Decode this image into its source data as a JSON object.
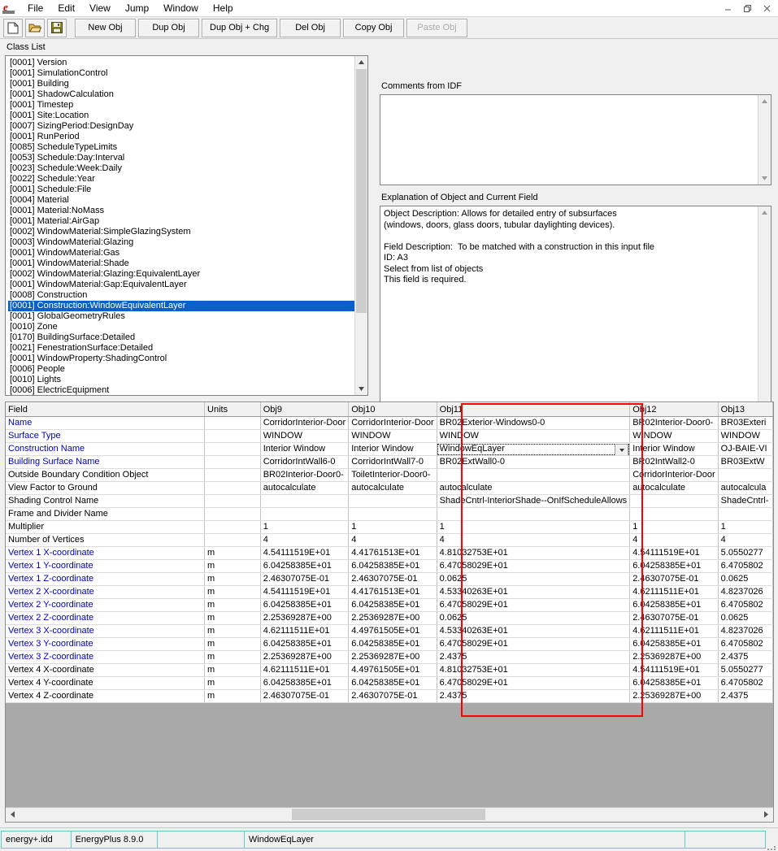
{
  "window": {
    "app_icon": "energyplus-idf-editor-icon",
    "controls": {
      "minimize": "minimize-icon",
      "restore": "restore-icon",
      "close": "close-icon"
    }
  },
  "menubar": {
    "items": [
      {
        "label": "File"
      },
      {
        "label": "Edit"
      },
      {
        "label": "View"
      },
      {
        "label": "Jump"
      },
      {
        "label": "Window"
      },
      {
        "label": "Help"
      }
    ]
  },
  "toolbar": {
    "icons": [
      {
        "name": "new-file-icon"
      },
      {
        "name": "open-folder-icon"
      },
      {
        "name": "save-disk-icon"
      }
    ],
    "buttons": [
      {
        "label": "New Obj",
        "disabled": false
      },
      {
        "label": "Dup Obj",
        "disabled": false
      },
      {
        "label": "Dup Obj + Chg",
        "disabled": false
      },
      {
        "label": "Del Obj",
        "disabled": false
      },
      {
        "label": "Copy Obj",
        "disabled": false
      },
      {
        "label": "Paste Obj",
        "disabled": true
      }
    ]
  },
  "panes": {
    "class_list_label": "Class List",
    "comments_label": "Comments from IDF",
    "comments_value": "",
    "explanation_label": "Explanation of Object and Current Field",
    "explanation_text": "Object Description: Allows for detailed entry of subsurfaces\n(windows, doors, glass doors, tubular daylighting devices).\n\nField Description:  To be matched with a construction in this input file\nID: A3\nSelect from list of objects\nThis field is required."
  },
  "class_list": {
    "selected_index": 23,
    "items": [
      {
        "count": "[0001]",
        "label": "Version"
      },
      {
        "count": "[0001]",
        "label": "SimulationControl"
      },
      {
        "count": "[0001]",
        "label": "Building"
      },
      {
        "count": "[0001]",
        "label": "ShadowCalculation"
      },
      {
        "count": "[0001]",
        "label": "Timestep"
      },
      {
        "count": "[0001]",
        "label": "Site:Location"
      },
      {
        "count": "[0007]",
        "label": "SizingPeriod:DesignDay"
      },
      {
        "count": "[0001]",
        "label": "RunPeriod"
      },
      {
        "count": "[0085]",
        "label": "ScheduleTypeLimits"
      },
      {
        "count": "[0053]",
        "label": "Schedule:Day:Interval"
      },
      {
        "count": "[0023]",
        "label": "Schedule:Week:Daily"
      },
      {
        "count": "[0022]",
        "label": "Schedule:Year"
      },
      {
        "count": "[0001]",
        "label": "Schedule:File"
      },
      {
        "count": "[0004]",
        "label": "Material"
      },
      {
        "count": "[0001]",
        "label": "Material:NoMass"
      },
      {
        "count": "[0001]",
        "label": "Material:AirGap"
      },
      {
        "count": "[0002]",
        "label": "WindowMaterial:SimpleGlazingSystem"
      },
      {
        "count": "[0003]",
        "label": "WindowMaterial:Glazing"
      },
      {
        "count": "[0001]",
        "label": "WindowMaterial:Gas"
      },
      {
        "count": "[0001]",
        "label": "WindowMaterial:Shade"
      },
      {
        "count": "[0002]",
        "label": "WindowMaterial:Glazing:EquivalentLayer"
      },
      {
        "count": "[0001]",
        "label": "WindowMaterial:Gap:EquivalentLayer"
      },
      {
        "count": "[0008]",
        "label": "Construction"
      },
      {
        "count": "[0001]",
        "label": "Construction:WindowEquivalentLayer"
      },
      {
        "count": "[0001]",
        "label": "GlobalGeometryRules"
      },
      {
        "count": "[0010]",
        "label": "Zone"
      },
      {
        "count": "[0170]",
        "label": "BuildingSurface:Detailed"
      },
      {
        "count": "[0021]",
        "label": "FenestrationSurface:Detailed"
      },
      {
        "count": "[0001]",
        "label": "WindowProperty:ShadingControl"
      },
      {
        "count": "[0006]",
        "label": "People"
      },
      {
        "count": "[0010]",
        "label": "Lights"
      },
      {
        "count": "[0006]",
        "label": "ElectricEquipment"
      }
    ]
  },
  "grid": {
    "headers": [
      "Field",
      "Units",
      "Obj9",
      "Obj10",
      "Obj11",
      "Obj12",
      "Obj13"
    ],
    "highlighted_column": "Obj11",
    "editing_cell": {
      "column": "Obj11",
      "row": "Construction Name",
      "value": "WindowEqLayer",
      "dropdown": "chevron-down-icon"
    },
    "rows": [
      {
        "field": "Name",
        "required": true,
        "units": "",
        "values": [
          "CorridorInterior-Door",
          "CorridorInterior-Door",
          "BR02Exterior-Windows0-0",
          "BR02Interior-Door0-",
          "BR03Exteri"
        ]
      },
      {
        "field": "Surface Type",
        "required": true,
        "units": "",
        "values": [
          "WINDOW",
          "WINDOW",
          "WINDOW",
          "WINDOW",
          "WINDOW"
        ]
      },
      {
        "field": "Construction Name",
        "required": true,
        "units": "",
        "values": [
          "Interior Window",
          "Interior Window",
          "WindowEqLayer",
          "Interior Window",
          "OJ-BAIE-VI"
        ]
      },
      {
        "field": "Building Surface Name",
        "required": true,
        "units": "",
        "values": [
          "CorridorIntWall6-0",
          "CorridorIntWall7-0",
          "BR02ExtWall0-0",
          "BR02IntWall2-0",
          "BR03ExtW"
        ]
      },
      {
        "field": "Outside Boundary Condition Object",
        "required": false,
        "units": "",
        "values": [
          "BR02Interior-Door0-",
          "ToiletInterior-Door0-",
          "",
          "CorridorInterior-Door",
          ""
        ]
      },
      {
        "field": "View Factor to Ground",
        "required": false,
        "units": "",
        "values": [
          "autocalculate",
          "autocalculate",
          "autocalculate",
          "autocalculate",
          "autocalcula"
        ]
      },
      {
        "field": "Shading Control Name",
        "required": false,
        "units": "",
        "values": [
          "",
          "",
          "ShadeCntrl-InteriorShade--OnIfScheduleAllows",
          "",
          "ShadeCntrl-"
        ]
      },
      {
        "field": "Frame and Divider Name",
        "required": false,
        "units": "",
        "values": [
          "",
          "",
          "",
          "",
          ""
        ]
      },
      {
        "field": "Multiplier",
        "required": false,
        "units": "",
        "values": [
          "1",
          "1",
          "1",
          "1",
          "1"
        ]
      },
      {
        "field": "Number of Vertices",
        "required": false,
        "units": "",
        "values": [
          "4",
          "4",
          "4",
          "4",
          "4"
        ]
      },
      {
        "field": "Vertex 1 X-coordinate",
        "required": true,
        "units": "m",
        "values": [
          "4.54111519E+01",
          "4.41761513E+01",
          "4.81032753E+01",
          "4.54111519E+01",
          "5.0550277"
        ]
      },
      {
        "field": "Vertex 1 Y-coordinate",
        "required": true,
        "units": "m",
        "values": [
          "6.04258385E+01",
          "6.04258385E+01",
          "6.47058029E+01",
          "6.04258385E+01",
          "6.4705802"
        ]
      },
      {
        "field": "Vertex 1 Z-coordinate",
        "required": true,
        "units": "m",
        "values": [
          "2.46307075E-01",
          "2.46307075E-01",
          "0.0625",
          "2.46307075E-01",
          "0.0625"
        ]
      },
      {
        "field": "Vertex 2 X-coordinate",
        "required": true,
        "units": "m",
        "values": [
          "4.54111519E+01",
          "4.41761513E+01",
          "4.53340263E+01",
          "4.62111511E+01",
          "4.8237026"
        ]
      },
      {
        "field": "Vertex 2 Y-coordinate",
        "required": true,
        "units": "m",
        "values": [
          "6.04258385E+01",
          "6.04258385E+01",
          "6.47058029E+01",
          "6.04258385E+01",
          "6.4705802"
        ]
      },
      {
        "field": "Vertex 2 Z-coordinate",
        "required": true,
        "units": "m",
        "values": [
          "2.25369287E+00",
          "2.25369287E+00",
          "0.0625",
          "2.46307075E-01",
          "0.0625"
        ]
      },
      {
        "field": "Vertex 3 X-coordinate",
        "required": true,
        "units": "m",
        "values": [
          "4.62111511E+01",
          "4.49761505E+01",
          "4.53340263E+01",
          "4.62111511E+01",
          "4.8237026"
        ]
      },
      {
        "field": "Vertex 3 Y-coordinate",
        "required": true,
        "units": "m",
        "values": [
          "6.04258385E+01",
          "6.04258385E+01",
          "6.47058029E+01",
          "6.04258385E+01",
          "6.4705802"
        ]
      },
      {
        "field": "Vertex 3 Z-coordinate",
        "required": true,
        "units": "m",
        "values": [
          "2.25369287E+00",
          "2.25369287E+00",
          "2.4375",
          "2.25369287E+00",
          "2.4375"
        ]
      },
      {
        "field": "Vertex 4 X-coordinate",
        "required": false,
        "units": "m",
        "values": [
          "4.62111511E+01",
          "4.49761505E+01",
          "4.81032753E+01",
          "4.54111519E+01",
          "5.0550277"
        ]
      },
      {
        "field": "Vertex 4 Y-coordinate",
        "required": false,
        "units": "m",
        "values": [
          "6.04258385E+01",
          "6.04258385E+01",
          "6.47058029E+01",
          "6.04258385E+01",
          "6.4705802"
        ]
      },
      {
        "field": "Vertex 4 Z-coordinate",
        "required": false,
        "units": "m",
        "values": [
          "2.46307075E-01",
          "2.46307075E-01",
          "2.4375",
          "2.25369287E+00",
          "2.4375"
        ]
      }
    ]
  },
  "statusbar": {
    "idd_file": "energy+.idd",
    "version": "EnergyPlus 8.9.0",
    "spacer": "",
    "current_value": "WindowEqLayer",
    "right": ""
  },
  "colors": {
    "selection": "#0a60c8",
    "required_field": "#0000c8",
    "annotation": "#ff0000",
    "status_border": "#64c8c8"
  }
}
